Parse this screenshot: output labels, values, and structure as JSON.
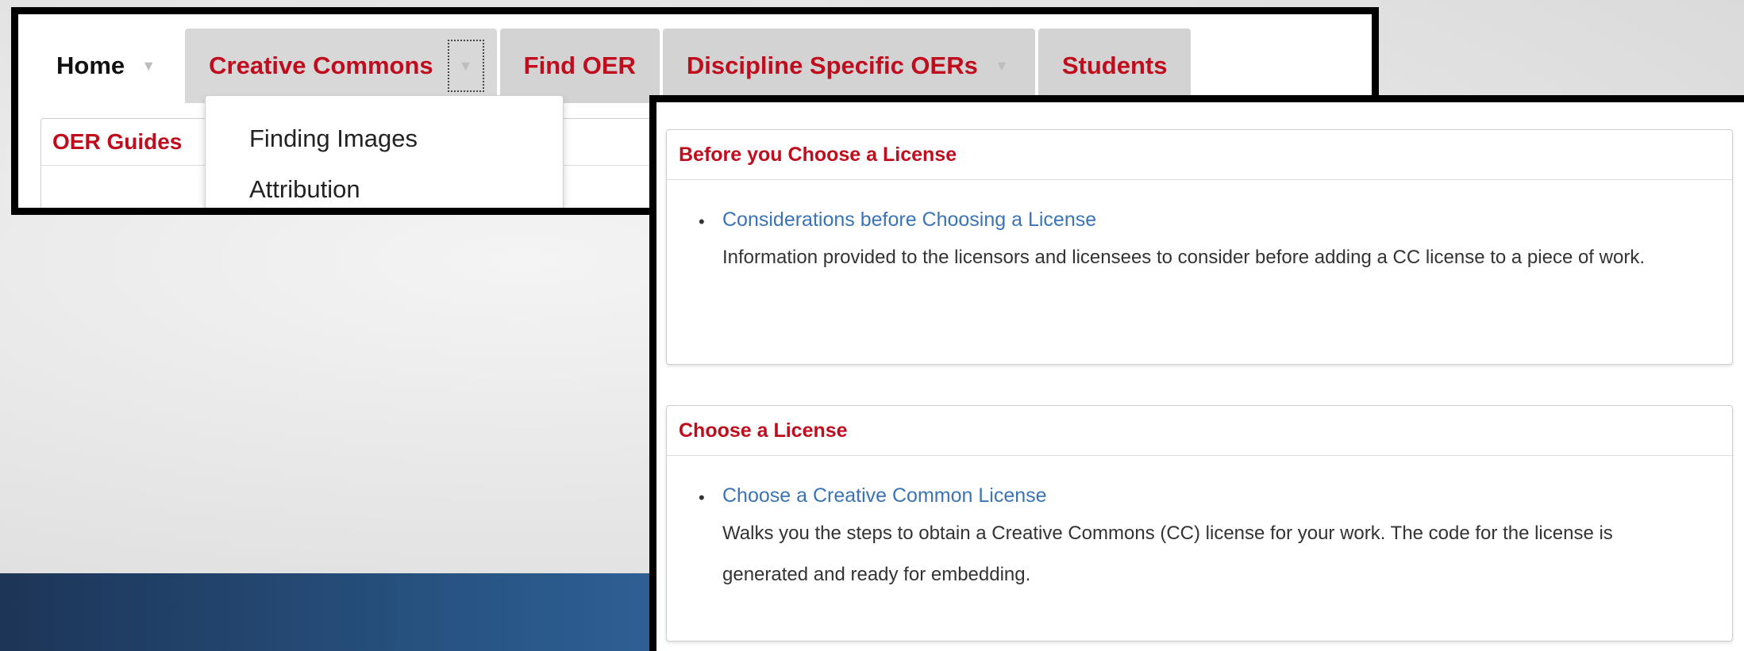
{
  "nav": {
    "tabs": [
      {
        "label": "Home"
      },
      {
        "label": "Creative Commons"
      },
      {
        "label": "Find OER"
      },
      {
        "label": "Discipline Specific OERs"
      },
      {
        "label": "Students"
      }
    ],
    "dropdown": [
      "Finding Images",
      "Attribution"
    ],
    "content_header": "OER Guides"
  },
  "sections": [
    {
      "title": "Before you Choose a License",
      "link": "Considerations before Choosing a License",
      "description": "Information provided to the licensors and licensees to consider before adding a CC license to a piece of work."
    },
    {
      "title": "Choose a License",
      "link": "Choose a Creative Common License",
      "description": "Walks you the steps to obtain a Creative Commons (CC) license for your work. The code for the license is generated and ready for embedding."
    }
  ],
  "colors": {
    "accent_red": "#c00d1e",
    "link_blue": "#3a73b6",
    "tab_gray": "#d3d3d3",
    "band_blue": "#2a5a8c"
  }
}
